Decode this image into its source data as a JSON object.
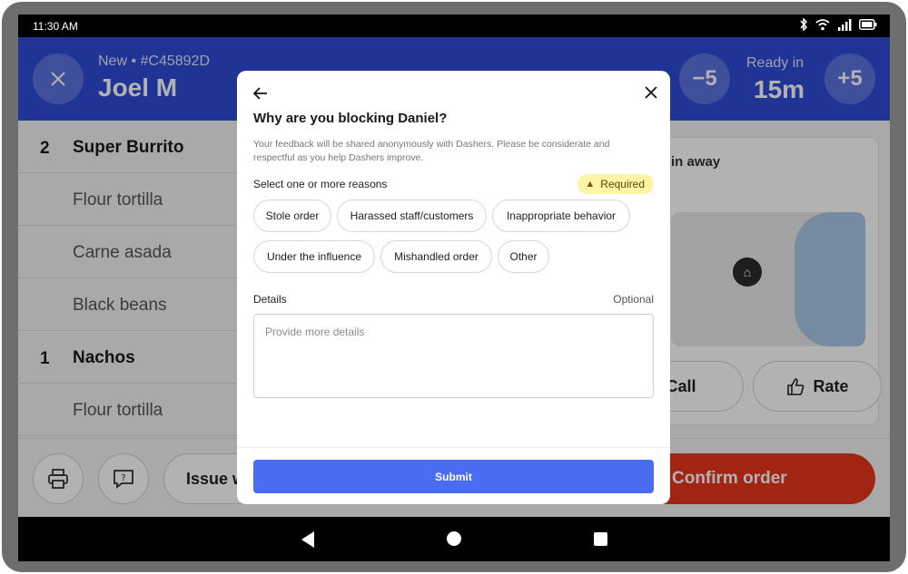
{
  "status_bar": {
    "time": "11:30 AM"
  },
  "header": {
    "close_icon": "close-icon",
    "order_meta": "New • #C45892D",
    "customer_name": "Joel M",
    "minus_label": "−5",
    "ready_label": "Ready in",
    "ready_value": "15m",
    "plus_label": "+5"
  },
  "order_items": [
    {
      "qty": "2",
      "name": "Super Burrito"
    },
    {
      "qty": "",
      "name": "Flour tortilla"
    },
    {
      "qty": "",
      "name": "Carne asada"
    },
    {
      "qty": "",
      "name": "Black beans"
    },
    {
      "qty": "1",
      "name": "Nachos"
    },
    {
      "qty": "",
      "name": "Flour tortilla"
    }
  ],
  "dasher_card": {
    "eta_text": "in away",
    "call_label": "Call",
    "rate_label": "Rate"
  },
  "bottom_bar": {
    "issue_label": "Issue w",
    "confirm_label": "Confirm order"
  },
  "modal": {
    "title": "Why are you blocking Daniel?",
    "description": "Your feedback will be shared anonymously with Dashers. Please be considerate and respectful as you help Dashers improve.",
    "select_label": "Select one or more reasons",
    "required_label": "Required",
    "reasons": [
      "Stole order",
      "Harassed staff/customers",
      "Inappropriate behavior",
      "Under the influence",
      "Mishandled order",
      "Other"
    ],
    "details_label": "Details",
    "optional_label": "Optional",
    "details_placeholder": "Provide more details",
    "submit_label": "Submit"
  },
  "colors": {
    "header_blue": "#2f4bd6",
    "confirm_red": "#e8351e",
    "submit_blue": "#4a6cf0",
    "required_yellow": "#fdf4a6"
  }
}
